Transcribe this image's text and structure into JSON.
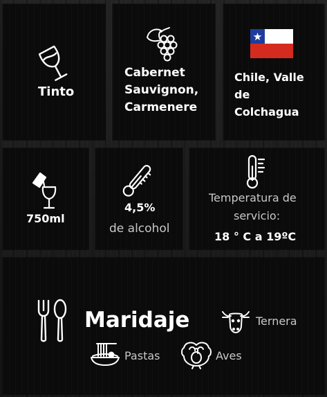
{
  "wine_type": "Tinto",
  "grapes": {
    "line1": "Cabernet",
    "line2": "Sauvignon,",
    "line3": "Carmenere"
  },
  "origin": {
    "line1": "Chile, Valle",
    "line2": "de",
    "line3": "Colchagua"
  },
  "volume": "750ml",
  "alcohol": {
    "value": "4,5%",
    "label": "de alcohol"
  },
  "temperature": {
    "label_line1": "Temperatura de",
    "label_line2": "servicio:",
    "value": "18 ° C a 19ºC"
  },
  "pairing": {
    "title": "Maridaje",
    "items": {
      "beef": "Ternera",
      "pasta": "Pastas",
      "poultry": "Aves"
    }
  },
  "colors": {
    "flag_blue": "#1e3c9e",
    "flag_red": "#d52b1e",
    "flag_white": "#ffffff"
  },
  "icons": [
    "wine-glass-icon",
    "grapes-icon",
    "chile-flag-icon",
    "bottle-pour-icon",
    "thermometer-icon",
    "thermometer-scale-icon",
    "cutlery-icon",
    "cow-icon",
    "pasta-icon",
    "turkey-icon"
  ]
}
